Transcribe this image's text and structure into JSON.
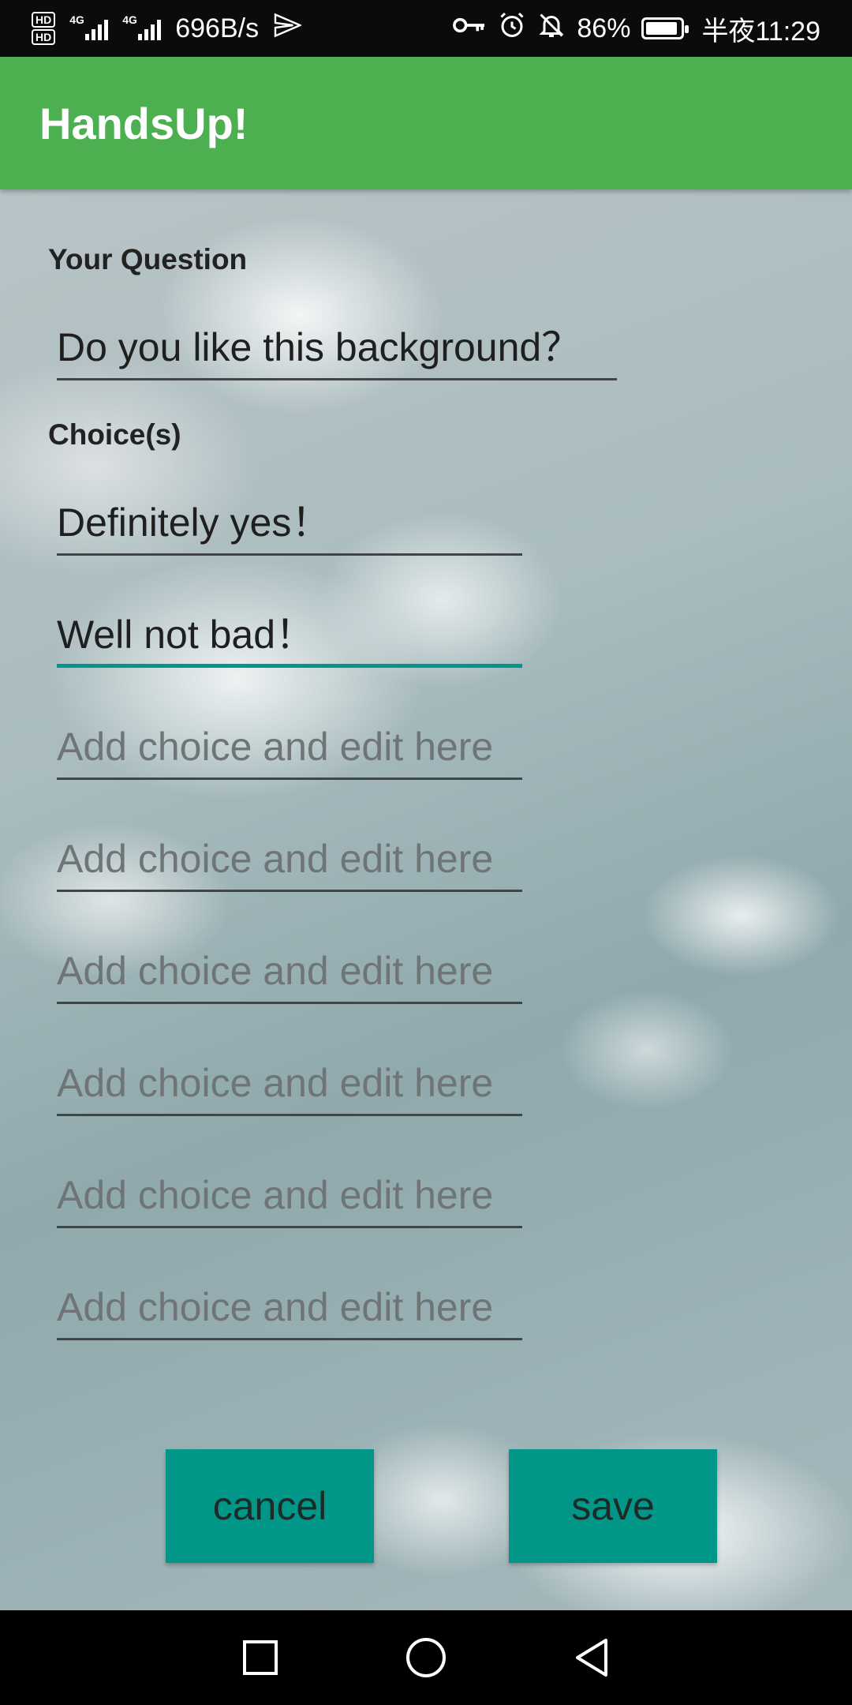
{
  "status_bar": {
    "hd1": "HD",
    "hd2": "HD",
    "network1": "4G",
    "network2": "4G",
    "speed": "696B/s",
    "battery": "86%",
    "time": "半夜11:29",
    "icons": [
      "key-icon",
      "alarm-icon",
      "mute-icon",
      "battery-icon",
      "send-icon"
    ]
  },
  "app_bar": {
    "title": "HandsUp!"
  },
  "form": {
    "question_label": "Your Question",
    "question_value": "Do you like this background？",
    "choices_label": "Choice(s)",
    "choices": [
      {
        "value": "Definitely yes！",
        "placeholder": ""
      },
      {
        "value": "Well not bad！",
        "placeholder": ""
      },
      {
        "value": "",
        "placeholder": "Add choice and edit here"
      },
      {
        "value": "",
        "placeholder": "Add choice and edit here"
      },
      {
        "value": "",
        "placeholder": "Add choice and edit here"
      },
      {
        "value": "",
        "placeholder": "Add choice and edit here"
      },
      {
        "value": "",
        "placeholder": "Add choice and edit here"
      },
      {
        "value": "",
        "placeholder": "Add choice and edit here"
      }
    ]
  },
  "buttons": {
    "cancel": "cancel",
    "save": "save"
  },
  "nav": {
    "icons": [
      "recents-icon",
      "home-icon",
      "back-icon"
    ]
  },
  "colors": {
    "app_bar": "#4caf50",
    "accent": "#009688"
  }
}
